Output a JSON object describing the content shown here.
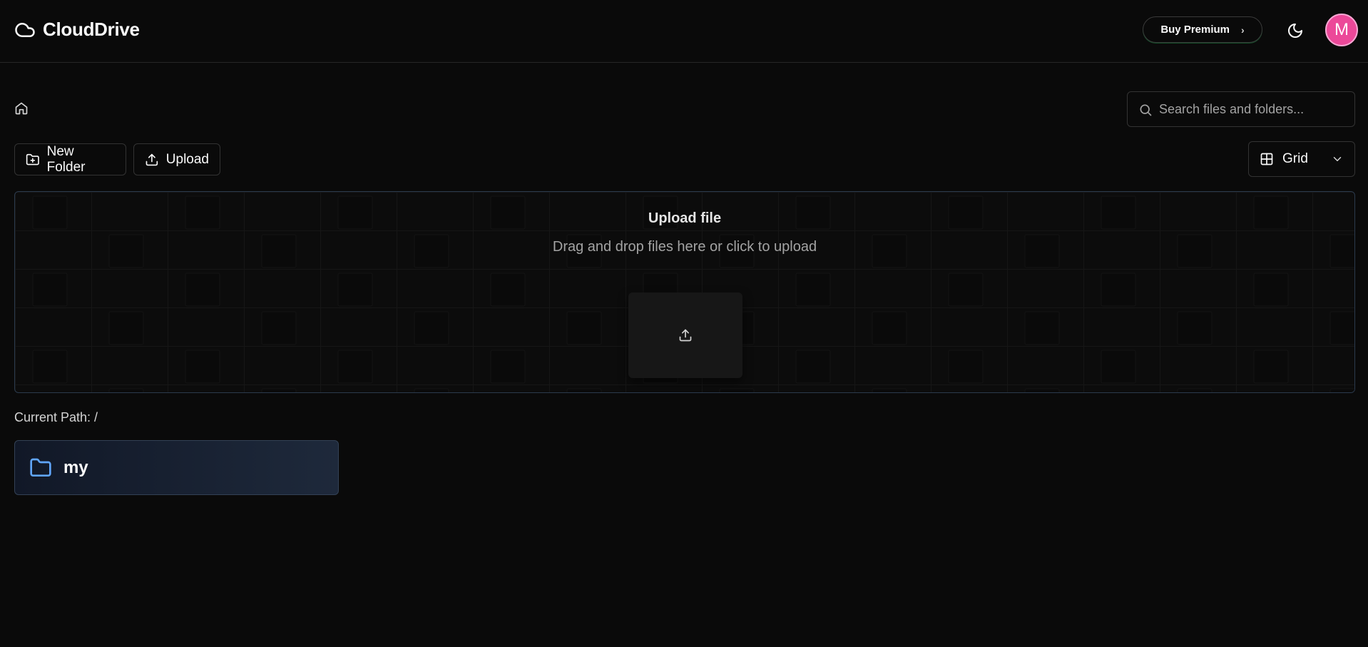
{
  "header": {
    "brand_name": "CloudDrive",
    "premium_label": "Buy Premium",
    "premium_chevron": "›",
    "avatar_initial": "M",
    "accent_avatar": "#ec4899"
  },
  "search": {
    "placeholder": "Search files and folders..."
  },
  "toolbar": {
    "new_folder_label": "New Folder",
    "upload_label": "Upload",
    "view_selected": "Grid"
  },
  "dropzone": {
    "title": "Upload file",
    "subtitle": "Drag and drop files here or click to upload"
  },
  "path": {
    "label": "Current Path: /"
  },
  "folders": [
    {
      "name": "my",
      "icon": "folder-icon",
      "color": "#60a5fa"
    }
  ],
  "icons": [
    "cloud-icon",
    "moon-icon",
    "home-icon",
    "search-icon",
    "folder-plus-icon",
    "upload-icon",
    "grid-icon",
    "chevron-down-icon",
    "folder-icon"
  ]
}
